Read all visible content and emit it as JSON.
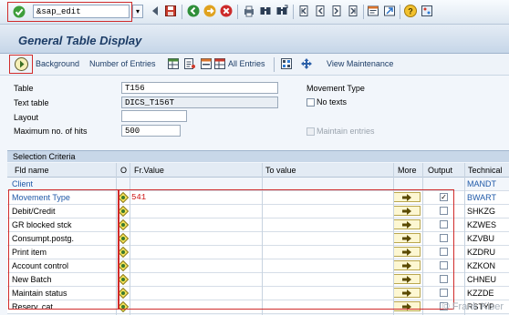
{
  "toolbar": {
    "command_value": "&sap_edit",
    "icons": [
      "enter-icon",
      "back-icon",
      "save-icon",
      "green-back-icon",
      "exit-icon",
      "cancel-icon",
      "print-icon",
      "find-icon",
      "find-next-icon",
      "first-page-icon",
      "previous-page-icon",
      "next-page-icon",
      "last-page-icon",
      "create-session-icon",
      "shortcut-icon",
      "help-icon",
      "customize-icon"
    ]
  },
  "title": "General Table Display",
  "app_toolbar": {
    "background_label": "Background",
    "entries_label": "Number of Entries",
    "all_entries_label": "All Entries",
    "view_maintenance_label": "View Maintenance"
  },
  "form": {
    "table_label": "Table",
    "table_value": "T156",
    "text_table_label": "Text table",
    "text_table_value": "DICS_T156T",
    "layout_label": "Layout",
    "layout_value": "",
    "max_hits_label": "Maximum no. of hits",
    "max_hits_value": "500",
    "movement_type_label": "Movement Type",
    "no_texts_label": "No texts",
    "maintain_entries_label": "Maintain entries"
  },
  "criteria": {
    "section_label": "Selection Criteria",
    "columns": {
      "fld_name": "Fld name",
      "o": "O",
      "fr_value": "Fr.Value",
      "to_value": "To value",
      "more": "More",
      "output": "Output",
      "technical": "Technical"
    },
    "client_row": {
      "name": "Client",
      "technical": "MANDT"
    },
    "rows": [
      {
        "name": "Movement Type",
        "fr_value": "541",
        "output": "✓",
        "technical": "BWART"
      },
      {
        "name": "Debit/Credit",
        "fr_value": "",
        "output": "",
        "technical": "SHKZG"
      },
      {
        "name": "GR blocked stck",
        "fr_value": "",
        "output": "",
        "technical": "KZWES"
      },
      {
        "name": "Consumpt.postg.",
        "fr_value": "",
        "output": "",
        "technical": "KZVBU"
      },
      {
        "name": "Print item",
        "fr_value": "",
        "output": "",
        "technical": "KZDRU"
      },
      {
        "name": "Account control",
        "fr_value": "",
        "output": "",
        "technical": "KZKON"
      },
      {
        "name": "New Batch",
        "fr_value": "",
        "output": "",
        "technical": "CHNEU"
      },
      {
        "name": "Maintain status",
        "fr_value": "",
        "output": "",
        "technical": "KZZDE"
      },
      {
        "name": "Reserv. cat.",
        "fr_value": "",
        "output": "",
        "technical": "RSTYP"
      }
    ]
  },
  "watermark": "© Frank Kiser"
}
